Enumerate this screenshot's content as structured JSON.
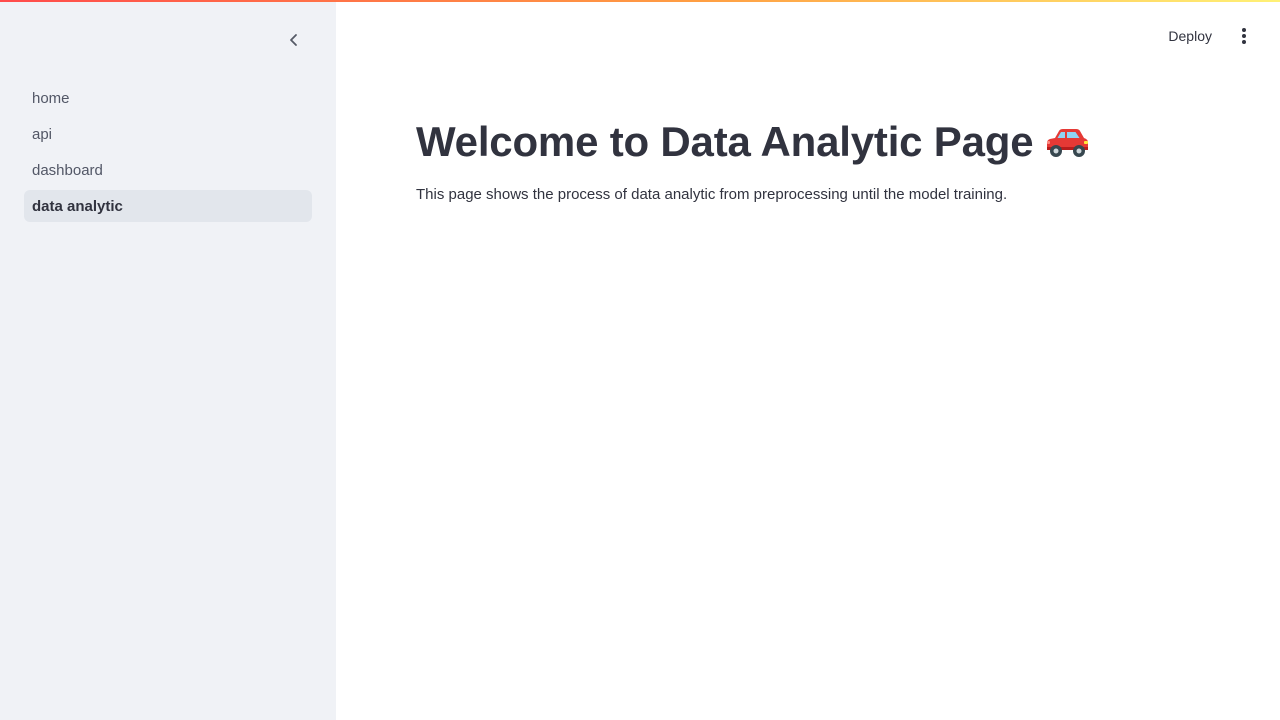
{
  "sidebar": {
    "collapse_icon": "chevron-left-icon",
    "items": [
      {
        "label": "home",
        "active": false
      },
      {
        "label": "api",
        "active": false
      },
      {
        "label": "dashboard",
        "active": false
      },
      {
        "label": "data analytic",
        "active": true
      }
    ]
  },
  "header": {
    "deploy_label": "Deploy",
    "menu_icon": "more-vertical-icon"
  },
  "main": {
    "title": "Welcome to Data Analytic Page",
    "title_icon": "red-car-icon",
    "description": "This page shows the process of data analytic from preprocessing until the model training."
  },
  "colors": {
    "sidebar_bg": "#f0f2f6",
    "active_item_bg": "#e2e6ec",
    "text": "#31333f",
    "top_bar_gradient": [
      "#ff4b4b",
      "#ff9f43",
      "#fff176"
    ]
  }
}
